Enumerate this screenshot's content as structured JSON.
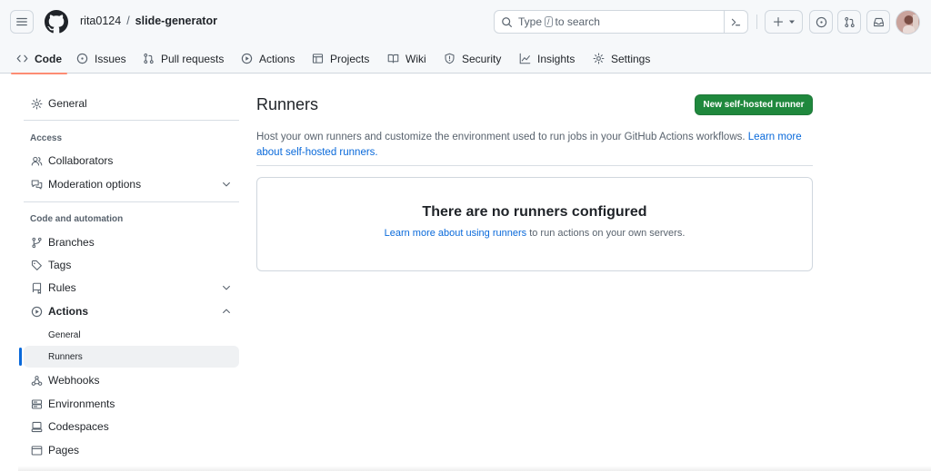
{
  "header": {
    "owner": "rita0124",
    "separator": "/",
    "repo": "slide-generator",
    "search": {
      "prefix": "Type",
      "key": "/",
      "suffix": "to search"
    }
  },
  "tabs": [
    {
      "label": "Code",
      "icon": "code-icon",
      "active": true
    },
    {
      "label": "Issues",
      "icon": "issue-opened-icon"
    },
    {
      "label": "Pull requests",
      "icon": "git-pull-request-icon"
    },
    {
      "label": "Actions",
      "icon": "play-icon"
    },
    {
      "label": "Projects",
      "icon": "table-icon"
    },
    {
      "label": "Wiki",
      "icon": "book-icon"
    },
    {
      "label": "Security",
      "icon": "shield-icon"
    },
    {
      "label": "Insights",
      "icon": "graph-icon"
    },
    {
      "label": "Settings",
      "icon": "gear-icon"
    }
  ],
  "sidebar": {
    "general": "General",
    "access_heading": "Access",
    "collaborators": "Collaborators",
    "moderation": "Moderation options",
    "code_heading": "Code and automation",
    "branches": "Branches",
    "tags": "Tags",
    "rules": "Rules",
    "actions": "Actions",
    "actions_general": "General",
    "actions_runners": "Runners",
    "webhooks": "Webhooks",
    "environments": "Environments",
    "codespaces": "Codespaces",
    "pages": "Pages"
  },
  "main": {
    "title": "Runners",
    "new_button": "New self-hosted runner",
    "description": "Host your own runners and customize the environment used to run jobs in your GitHub Actions workflows.",
    "description_link": "Learn more about self-hosted runners.",
    "empty_title": "There are no runners configured",
    "empty_link": "Learn more about using runners",
    "empty_suffix": "to run actions on your own servers."
  },
  "colors": {
    "accent": "#0969da",
    "primary_button": "#1f883d",
    "active_tab_underline": "#fd8c73"
  }
}
